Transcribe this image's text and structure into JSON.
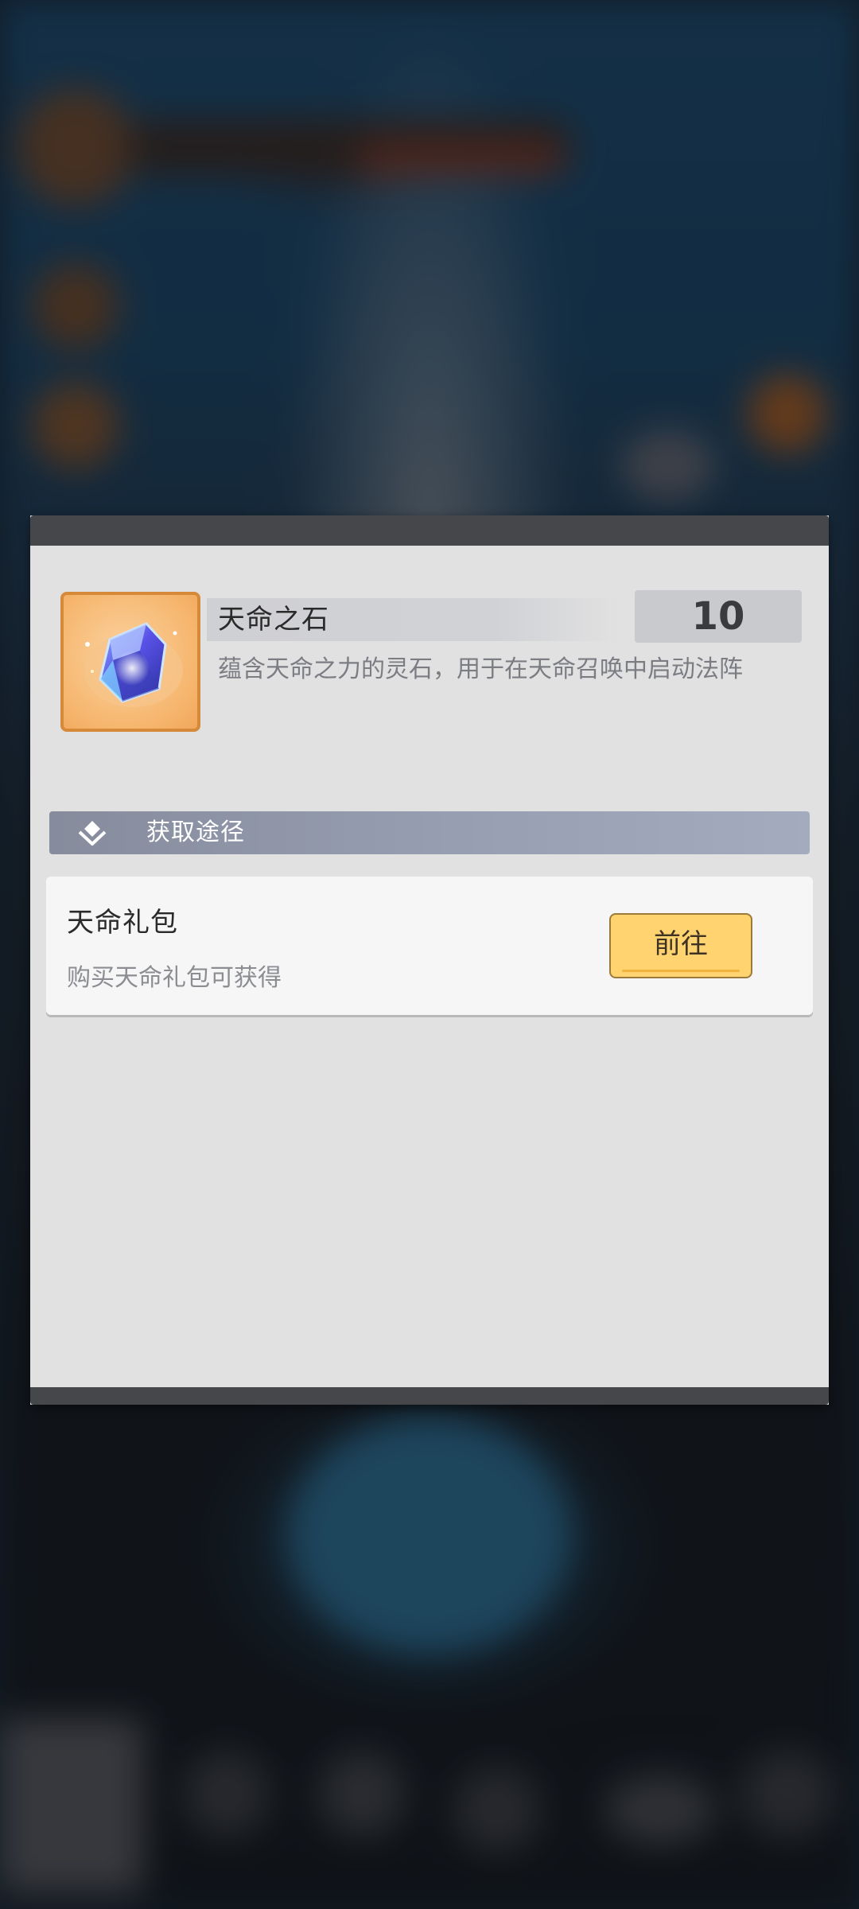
{
  "item": {
    "name": "天命之石",
    "count": "10",
    "description": "蕴含天命之力的灵石，用于在天命召唤中启动法阵",
    "icon": "destiny-stone-gem-icon"
  },
  "section": {
    "title": "获取途径",
    "icon": "diamond-chevron-icon"
  },
  "sources": [
    {
      "title": "天命礼包",
      "description": "购买天命礼包可获得",
      "button_label": "前往"
    }
  ],
  "colors": {
    "dialog_bg": "#e1e1e1",
    "dialog_frame": "#46474b",
    "button_bg": "#ffd36f",
    "icon_frame": "#d7893a",
    "section_header": "#969db0"
  }
}
